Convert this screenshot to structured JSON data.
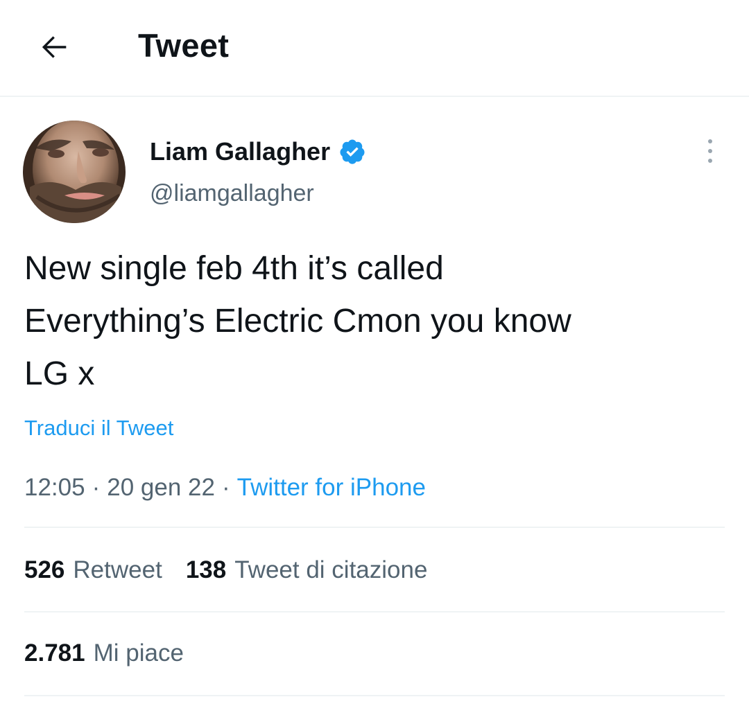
{
  "header": {
    "title": "Tweet"
  },
  "author": {
    "name": "Liam Gallagher",
    "handle": "@liamgallagher",
    "verified": true
  },
  "tweet": {
    "text": "New single feb 4th it’s called\nEverything’s Electric Cmon you know\nLG x",
    "translate_label": "Traduci il Tweet",
    "time": "12:05",
    "separator": "·",
    "date": "20 gen 22",
    "source": "Twitter for iPhone"
  },
  "stats": {
    "retweets_count": "526",
    "retweets_label": "Retweet",
    "quotes_count": "138",
    "quotes_label": "Tweet di citazione",
    "likes_count": "2.781",
    "likes_label": "Mi piace"
  },
  "colors": {
    "accent": "#1d9bf0",
    "text": "#0f1419",
    "secondary": "#536471",
    "divider": "#eff3f4"
  },
  "icons": {
    "back": "arrow-left-icon",
    "verified": "verified-badge-icon",
    "more": "more-vertical-icon"
  }
}
